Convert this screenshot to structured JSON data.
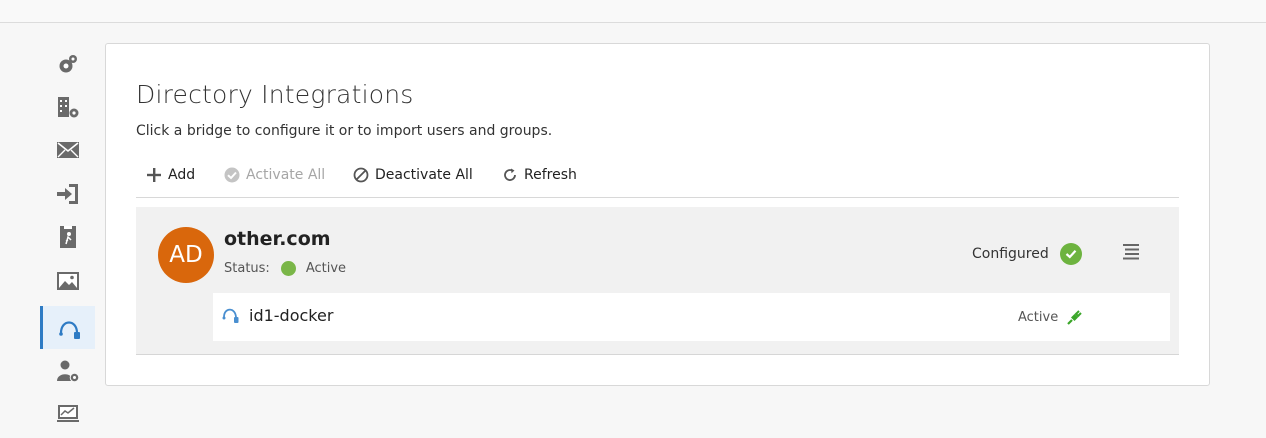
{
  "sidebar": {
    "items": [
      {
        "icon": "settings-gear-icon"
      },
      {
        "icon": "building-settings-icon"
      },
      {
        "icon": "envelope-icon"
      },
      {
        "icon": "sign-in-arrow-icon"
      },
      {
        "icon": "document-person-icon"
      },
      {
        "icon": "image-icon"
      },
      {
        "icon": "directory-cable-icon",
        "active": true
      },
      {
        "icon": "user-settings-icon"
      },
      {
        "icon": "monitor-chart-icon"
      }
    ]
  },
  "page": {
    "title": "Directory Integrations",
    "subtitle": "Click a bridge to configure it or to import users and groups."
  },
  "toolbar": {
    "add_label": "Add",
    "activate_all_label": "Activate All",
    "deactivate_all_label": "Deactivate All",
    "refresh_label": "Refresh"
  },
  "bridge": {
    "avatar_initials": "AD",
    "avatar_color": "#d9670c",
    "name": "other.com",
    "status_label": "Status:",
    "status_value": "Active",
    "status_color": "#7ab648",
    "configured_label": "Configured",
    "agents": [
      {
        "name": "id1-docker",
        "status": "Active",
        "status_color": "#3aa629"
      }
    ]
  },
  "colors": {
    "accent": "#2e7bc4",
    "success": "#6db33f"
  }
}
